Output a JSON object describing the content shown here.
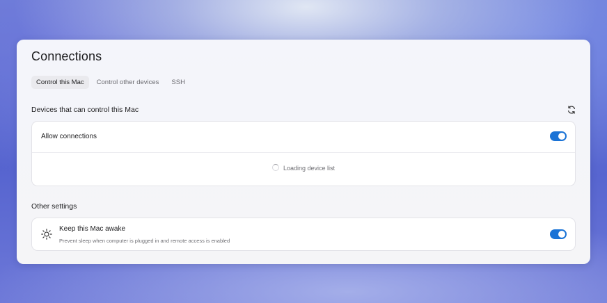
{
  "page": {
    "title": "Connections"
  },
  "tabs": [
    {
      "label": "Control this Mac",
      "active": true
    },
    {
      "label": "Control other devices",
      "active": false
    },
    {
      "label": "SSH",
      "active": false
    }
  ],
  "devices_section": {
    "heading": "Devices that can control this Mac",
    "refresh_icon": "refresh-icon",
    "allow_connections": {
      "label": "Allow connections",
      "enabled": true
    },
    "loading_text": "Loading device list"
  },
  "other_section": {
    "heading": "Other settings",
    "keep_awake": {
      "icon": "sun-icon",
      "title": "Keep this Mac awake",
      "description": "Prevent sleep when computer is plugged in and remote access is enabled",
      "enabled": true
    }
  },
  "colors": {
    "accent": "#1a73d6",
    "panel": "#f5f5f7",
    "card": "#ffffff"
  }
}
